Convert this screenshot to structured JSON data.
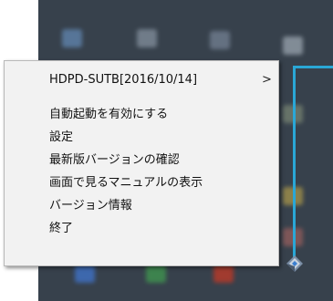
{
  "menu": {
    "header": {
      "label": "HDPD-SUTB[2016/10/14]",
      "submenu_arrow": "chevron-right-icon"
    },
    "items": [
      {
        "label": "自動起動を有効にする"
      },
      {
        "label": "設定"
      },
      {
        "label": "最新版バージョンの確認"
      },
      {
        "label": "画面で見るマニュアルの表示"
      },
      {
        "label": "バージョン情報"
      },
      {
        "label": "終了"
      }
    ]
  },
  "colors": {
    "taskbar": "#37414c",
    "menu_bg": "#f2f2f2",
    "callout": "#2aa7d6"
  }
}
